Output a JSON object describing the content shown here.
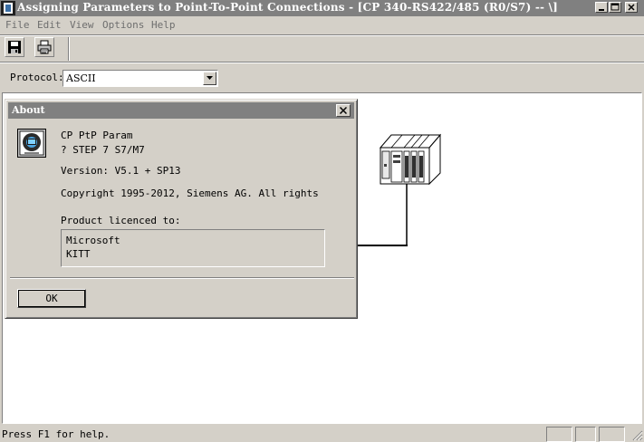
{
  "window": {
    "title": "Assigning Parameters to Point-To-Point Connections - [CP 340-RS422/485  (R0/S7)  -- \\]"
  },
  "menu": {
    "items": [
      {
        "label": "File"
      },
      {
        "label": "Edit"
      },
      {
        "label": "View"
      },
      {
        "label": "Options"
      },
      {
        "label": "Help"
      }
    ]
  },
  "toolbar": {
    "buttons": [
      {
        "icon": "save-icon"
      },
      {
        "icon": "print-icon"
      }
    ]
  },
  "protocol": {
    "label": "Protocol:",
    "value": "ASCII"
  },
  "about": {
    "title": "About",
    "product": "CP PtP Param",
    "platform": "? STEP 7  S7/M7",
    "version": "Version:  V5.1 + SP13",
    "copyright": "Copyright  1995-2012, Siemens AG. All rights",
    "licensed_label": "Product licenced to:",
    "licensee_line1": "Microsoft",
    "licensee_line2": "KITT",
    "ok_label": "OK"
  },
  "status": {
    "text": "Press F1 for help."
  },
  "colors": {
    "face": "#d4d0c8",
    "titlebar_inactive": "#808080",
    "workarea": "#ffffff"
  }
}
